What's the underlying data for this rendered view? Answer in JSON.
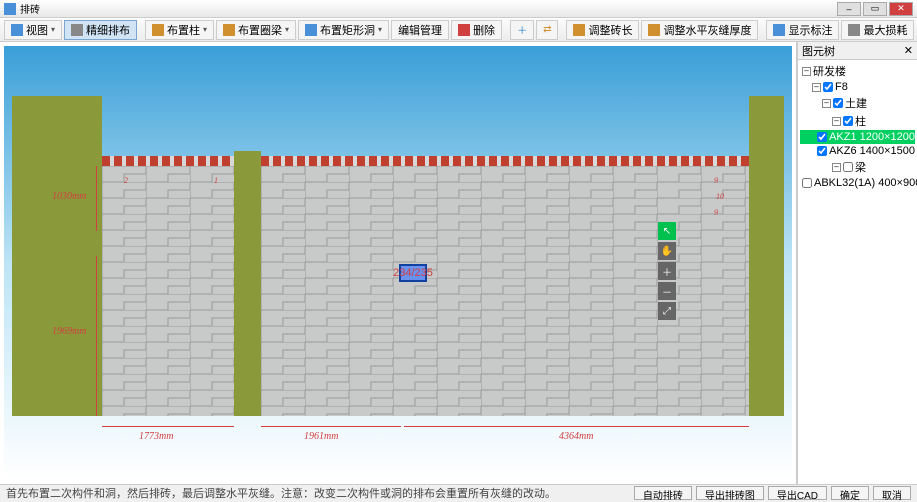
{
  "window": {
    "title": "排砖"
  },
  "toolbar": {
    "btn_view": "视图",
    "btn_fine": "精细排布",
    "btn_col": "布置柱",
    "btn_beam": "布置圈梁",
    "btn_rect": "布置矩形洞",
    "btn_edit": "编辑管理",
    "btn_del": "删除",
    "btn_adj_len": "调整砖长",
    "btn_adj_thick": "调整水平灰缝厚度",
    "btn_show_label": "显示标注",
    "btn_max": "最大损耗"
  },
  "dimensions": {
    "h1": "1030mm",
    "h2": "1969mm",
    "w1": "1773mm",
    "w2": "1961mm",
    "w3": "4364mm",
    "sel": "234/235"
  },
  "tree": {
    "title": "图元树",
    "root": "研发楼",
    "floor": "F8",
    "cat1": "土建",
    "sub_col": "柱",
    "item1": "AKZ1 1200×1200",
    "item2": "AKZ6 1400×1500",
    "sub_beam": "梁",
    "item3": "ABKL32(1A) 400×900"
  },
  "status": {
    "msg": "首先布置二次构件和洞，然后排砖，最后调整水平灰缝。注意：改变二次构件或洞的排布会重置所有灰缝的改动。",
    "b1": "自动排砖",
    "b2": "导出排砖图",
    "b3": "导出CAD",
    "b4": "确定",
    "b5": "取消"
  },
  "chart_data": {
    "type": "diagram",
    "description": "Brick wall elevation with three segments separated by green pillars",
    "heights": [
      1030,
      1969
    ],
    "widths": [
      1773,
      1961,
      4364
    ],
    "selected_brick": "234/235"
  }
}
